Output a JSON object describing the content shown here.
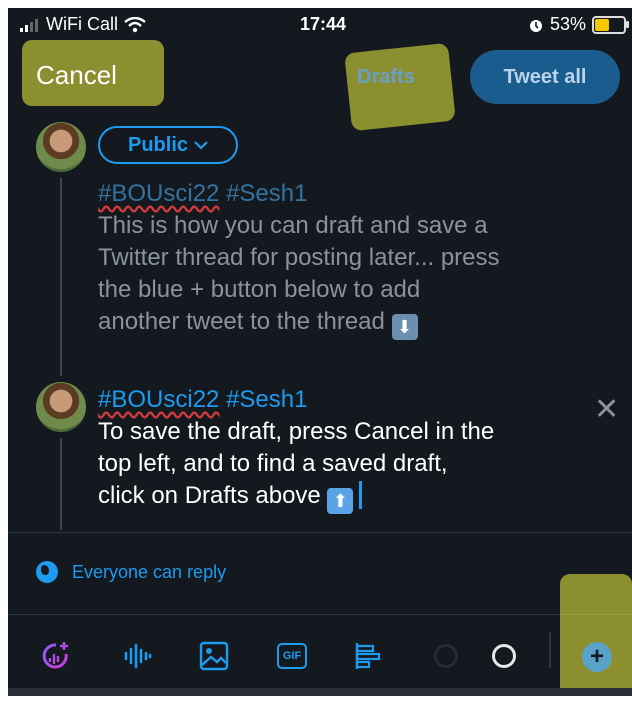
{
  "status_bar": {
    "carrier": "WiFi Call",
    "time": "17:44",
    "battery": "53%",
    "battery_level": 0.53
  },
  "header": {
    "cancel_label": "Cancel",
    "drafts_label": "Drafts",
    "tweet_all_label": "Tweet all"
  },
  "tweets": [
    {
      "audience": "Public",
      "hashtag_1": "#BOUsci22",
      "hashtag_2": "#Sesh1",
      "lines": [
        "This is how you can draft and save a",
        "Twitter thread for posting later... press",
        "the blue + button below to add",
        "another tweet to the thread"
      ],
      "emoji": "⬇"
    },
    {
      "hashtag_1": "#BOUsci22",
      "hashtag_2": "#Sesh1",
      "lines": [
        "To save the draft, press Cancel in the",
        "top left, and to find a saved draft,",
        "click on Drafts above"
      ],
      "emoji": "⬆"
    }
  ],
  "reply_setting": "Everyone can reply",
  "toolbar": {
    "icons": [
      "add-image-sparkle-icon",
      "voice-wave-icon",
      "image-icon",
      "gif-icon",
      "poll-icon",
      "character-count-ring-icon",
      "add-tweet-icon"
    ],
    "gif_label": "GIF",
    "add_label": "+"
  },
  "colors": {
    "background": "#14191f",
    "accent": "#1d9bf0",
    "highlight": "#eef03c"
  }
}
